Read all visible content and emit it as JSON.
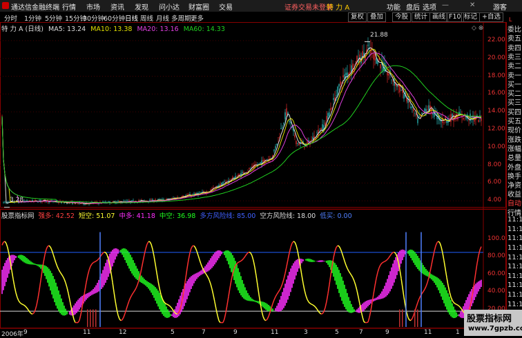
{
  "menubar": {
    "app_title": "通达信金融终端",
    "items": [
      "行情",
      "市场",
      "资讯",
      "发现",
      "问小达",
      "财富圈",
      "交易"
    ],
    "login_notice": "证券交易未登录",
    "stock": "特 力 A",
    "right_items": [
      "功能",
      "盘后",
      "选项"
    ],
    "guest": "游客"
  },
  "periodbar": {
    "periods": [
      "分时",
      "1分钟",
      "5分钟",
      "15分钟",
      "30分钟",
      "60分钟",
      "日线",
      "周线",
      "月线",
      "多周期",
      "更多"
    ],
    "active": "日线",
    "tools": [
      "复权",
      "叠加",
      "今股",
      "统计",
      "画线",
      "F10",
      "标记",
      "+自选"
    ]
  },
  "price_legend": {
    "name": "特 力 A (日线)",
    "ma5": "MA5: 13.24",
    "ma10": "MA10: 13.38",
    "ma20": "MA20: 13.16",
    "ma60": "MA60: 14.33",
    "high_label": "21.88",
    "low_label": "3.28"
  },
  "indicator_legend": {
    "name": "股票指标网",
    "items": [
      "强多: 42.52",
      "短空: 51.07",
      "中多: 41.18",
      "中空: 36.98",
      "多方风险线: 85.00",
      "空方风险线: 18.00",
      "低买: 0.00"
    ]
  },
  "price_axis": [
    "22.00",
    "20.00",
    "18.00",
    "16.00",
    "14.00",
    "12.00",
    "10.00",
    "8.00",
    "6.00",
    "4.00"
  ],
  "indicator_axis": [
    "100.0",
    "80.00",
    "60.00",
    "40.00",
    "20.00"
  ],
  "time_axis": [
    "2006年",
    "9",
    "11",
    "12",
    "5",
    "7",
    "9",
    "11",
    "3",
    "5",
    "7",
    "9",
    "11",
    "1"
  ],
  "right_panel": [
    "委比",
    "卖五",
    "卖四",
    "卖三",
    "卖二",
    "卖一",
    "买一",
    "买二",
    "买三",
    "买四",
    "买五",
    "现价",
    "涨跌",
    "涨幅",
    "总量",
    "外盘",
    "换手",
    "净资",
    "收益",
    "自动",
    "行情",
    "11:1",
    "11:1",
    "11:1",
    "11:1",
    "11:1",
    "11:1",
    "11:1",
    "11:1",
    "11:1",
    "11:1",
    "11:1",
    "11:1"
  ],
  "right_panel_marker": "L",
  "watermark": {
    "line1": "股票指标网",
    "line2": "www.7gpzb.com"
  },
  "colors": {
    "ma5": "#e0e0e0",
    "ma10": "#e0e000",
    "ma20": "#e040e0",
    "ma60": "#20d020",
    "up": "#ff3030",
    "down": "#30d0d0",
    "magenta": "#ff30ff",
    "green": "#20ff20",
    "yellow": "#ffff30",
    "risk_line": "#2060ff",
    "blue_bar": "#5080ff"
  }
}
